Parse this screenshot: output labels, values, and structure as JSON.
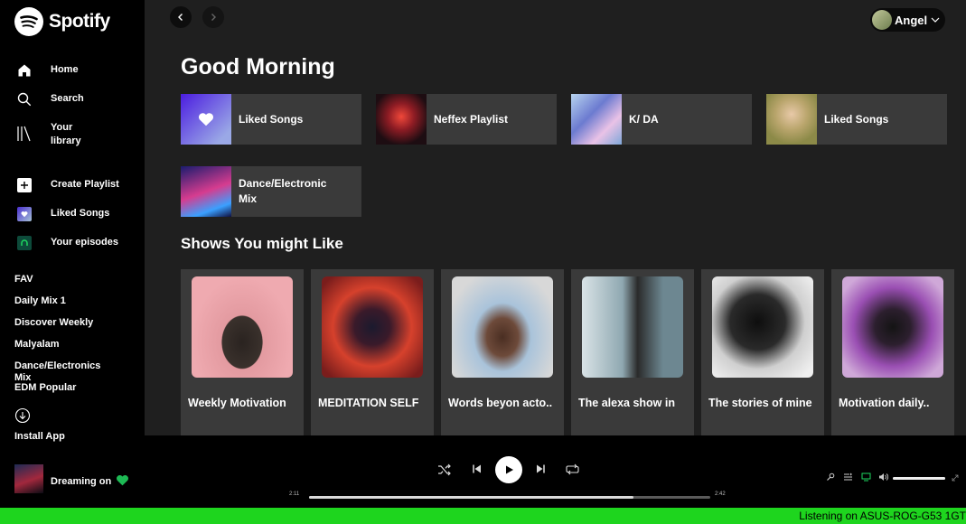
{
  "app": {
    "name": "Spotify"
  },
  "sidebar": {
    "nav": [
      {
        "label": "Home",
        "icon": "home-icon"
      },
      {
        "label": "Search",
        "icon": "search-icon"
      },
      {
        "label": "Your library",
        "icon": "library-icon"
      }
    ],
    "actions": [
      {
        "label": "Create Playlist",
        "icon": "plus-icon"
      },
      {
        "label": "Liked Songs",
        "icon": "heart-icon"
      },
      {
        "label": "Your episodes",
        "icon": "episodes-icon"
      }
    ],
    "playlists": [
      "FAV",
      "Daily Mix 1",
      "Discover Weekly",
      "Malyalam",
      "Dance/Electronics Mix",
      "EDM Popular"
    ],
    "install_label": "Install App"
  },
  "header": {
    "user_name": "Angel"
  },
  "main": {
    "greeting": "Good Morning",
    "quick_picks": [
      {
        "title": "Liked Songs"
      },
      {
        "title": "Neffex Playlist"
      },
      {
        "title": "K/ DA"
      },
      {
        "title": "Liked Songs"
      },
      {
        "title": "Dance/Electronic Mix"
      }
    ],
    "shows_heading": "Shows You might Like",
    "shows": [
      {
        "title": "Weekly Motivation"
      },
      {
        "title": "MEDITATION SELF"
      },
      {
        "title": "Words beyon acto.."
      },
      {
        "title": "The alexa show in"
      },
      {
        "title": "The stories of mine"
      },
      {
        "title": "Motivation daily.."
      }
    ]
  },
  "player": {
    "track_title": "Dreaming on",
    "elapsed": "2:11",
    "duration": "2:42",
    "progress": 0.808,
    "volume": 1.0
  },
  "status_bar": {
    "text": "Listening on ASUS-ROG-G53 1GT"
  },
  "colors": {
    "accent": "#1ed51e",
    "liked": "#1db954"
  }
}
